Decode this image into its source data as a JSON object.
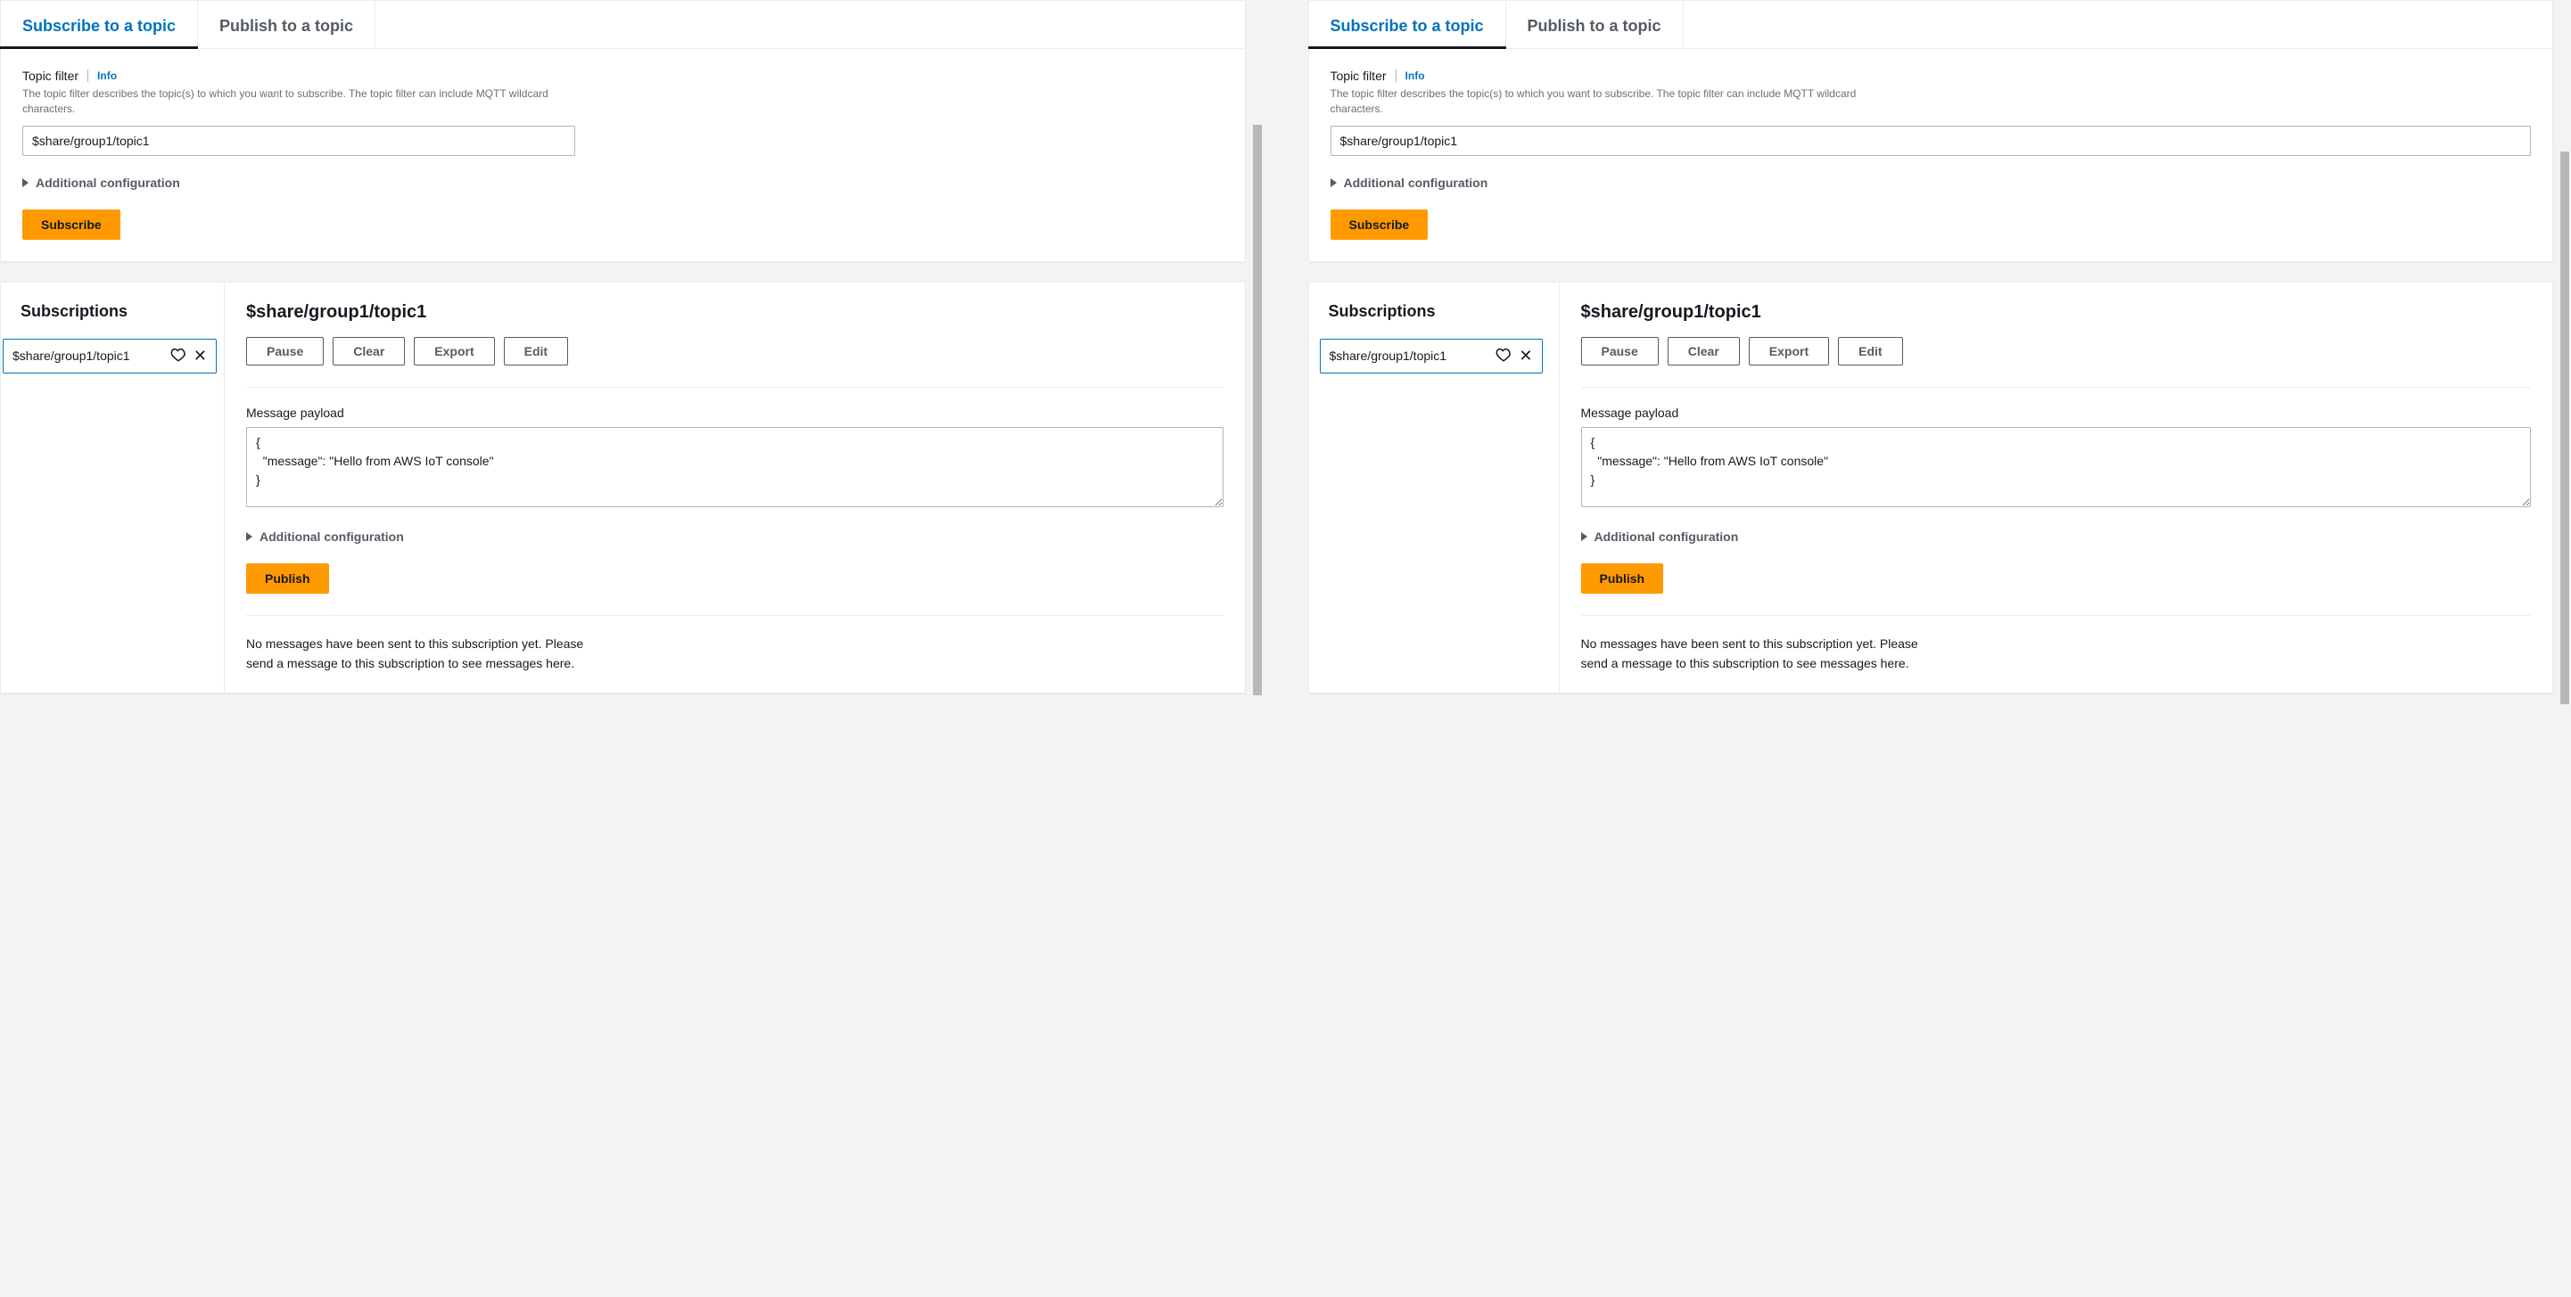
{
  "tabs": {
    "subscribe": "Subscribe to a topic",
    "publish": "Publish to a topic"
  },
  "topic_filter": {
    "label": "Topic filter",
    "info": "Info",
    "hint": "The topic filter describes the topic(s) to which you want to subscribe. The topic filter can include MQTT wildcard characters.",
    "value": "$share/group1/topic1"
  },
  "additional_config": "Additional configuration",
  "subscribe_btn": "Subscribe",
  "subscriptions": {
    "heading": "Subscriptions",
    "item": "$share/group1/topic1"
  },
  "detail": {
    "heading": "$share/group1/topic1",
    "buttons": {
      "pause": "Pause",
      "clear": "Clear",
      "export": "Export",
      "edit": "Edit"
    },
    "payload_label": "Message payload",
    "payload_value": "{\n  \"message\": \"Hello from AWS IoT console\"\n}",
    "publish_btn": "Publish",
    "empty": "No messages have been sent to this subscription yet. Please send a message to this subscription to see messages here."
  }
}
